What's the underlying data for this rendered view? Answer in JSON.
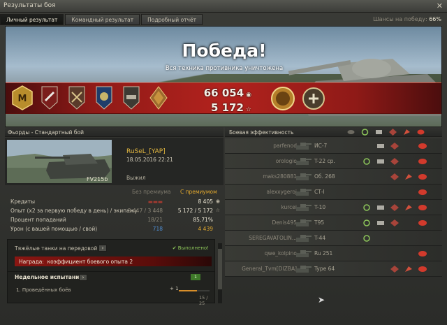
{
  "window": {
    "title": "Результаты боя",
    "close_glyph": "✕"
  },
  "tabs": [
    {
      "label": "Личный результат",
      "active": true
    },
    {
      "label": "Командный результат",
      "active": false
    },
    {
      "label": "Подробный отчёт",
      "active": false
    }
  ],
  "win_chance": {
    "label": "Шансы на победу:",
    "value": "66%"
  },
  "banner": {
    "title": "Победа!",
    "subtitle": "Вся техника противника уничтожена",
    "credits_value": "66 054",
    "credits_icon": "credits-icon",
    "xp_value": "5 172",
    "xp_icon": "☆",
    "medals": [
      "master-badge-icon",
      "sniper-medal-icon",
      "invader-medal-icon",
      "defender-medal-icon",
      "confederate-medal-icon",
      "tank-expert-medal-icon"
    ],
    "accent_color": "#b2221d"
  },
  "map": {
    "title": "Фьорды - Стандартный бой"
  },
  "player": {
    "name": "RuSeL_[YAP]",
    "date": "18.05.2016 22:21",
    "tank": "FV215b",
    "status": "Выжил"
  },
  "stats": {
    "col_no_premium": "Без премиума",
    "col_premium": "С премиумом",
    "rows": [
      {
        "label": "Кредиты",
        "v1": "",
        "v2": "8 405",
        "icon": "credits-icon"
      },
      {
        "label": "Опыт  (x2 за первую победу в день) / экипажу",
        "v1": "3 447 / 3 448",
        "v2": "5 172 / 5 172",
        "icon": "☆"
      },
      {
        "label": "Процент попаданий",
        "v1": "18/21",
        "v2": "85,71%",
        "icon": ""
      },
      {
        "label": "Урон (с вашей помощью / свой)",
        "v1": "718",
        "v2": "4 439",
        "icon": ""
      }
    ],
    "v1_damage_color": "#4f8fd4",
    "v2_damage_color": "#e0a82e"
  },
  "mission": {
    "title": "Тяжёлые танки на передовой",
    "status": "Выполнено!",
    "reward_label": "Награда:",
    "reward_text": "коэффициент боевого опыта 2"
  },
  "weekly": {
    "title": "Недельное испытание",
    "badge": "1",
    "task": "1. Проведённых боёв",
    "gain": "+ 1",
    "count": "15 / 25",
    "progress": 0.6
  },
  "efficiency": {
    "title": "Боевая эффективность",
    "header_icons": [
      "spotted-icon",
      "assist-icon",
      "armor-icon",
      "crits-icon",
      "damage-icon",
      "kill-icon"
    ]
  },
  "team": [
    {
      "name": "parfenod",
      "tank": "ИС-7"
    },
    {
      "name": "orologio",
      "tank": "T-22 ср."
    },
    {
      "name": "maks280881",
      "tank": "Об. 268"
    },
    {
      "name": "alexxygeroj",
      "tank": "СТ-I"
    },
    {
      "name": "kurcei",
      "tank": "T-10"
    },
    {
      "name": "Denis495",
      "tank": "T95"
    },
    {
      "name": "SEREGAVATOLIN...",
      "tank": "T-44"
    },
    {
      "name": "qwe_kolpino",
      "tank": "Ru 251"
    },
    {
      "name": "General_Tvm[DIZBA]",
      "tank": "Type 64"
    }
  ]
}
